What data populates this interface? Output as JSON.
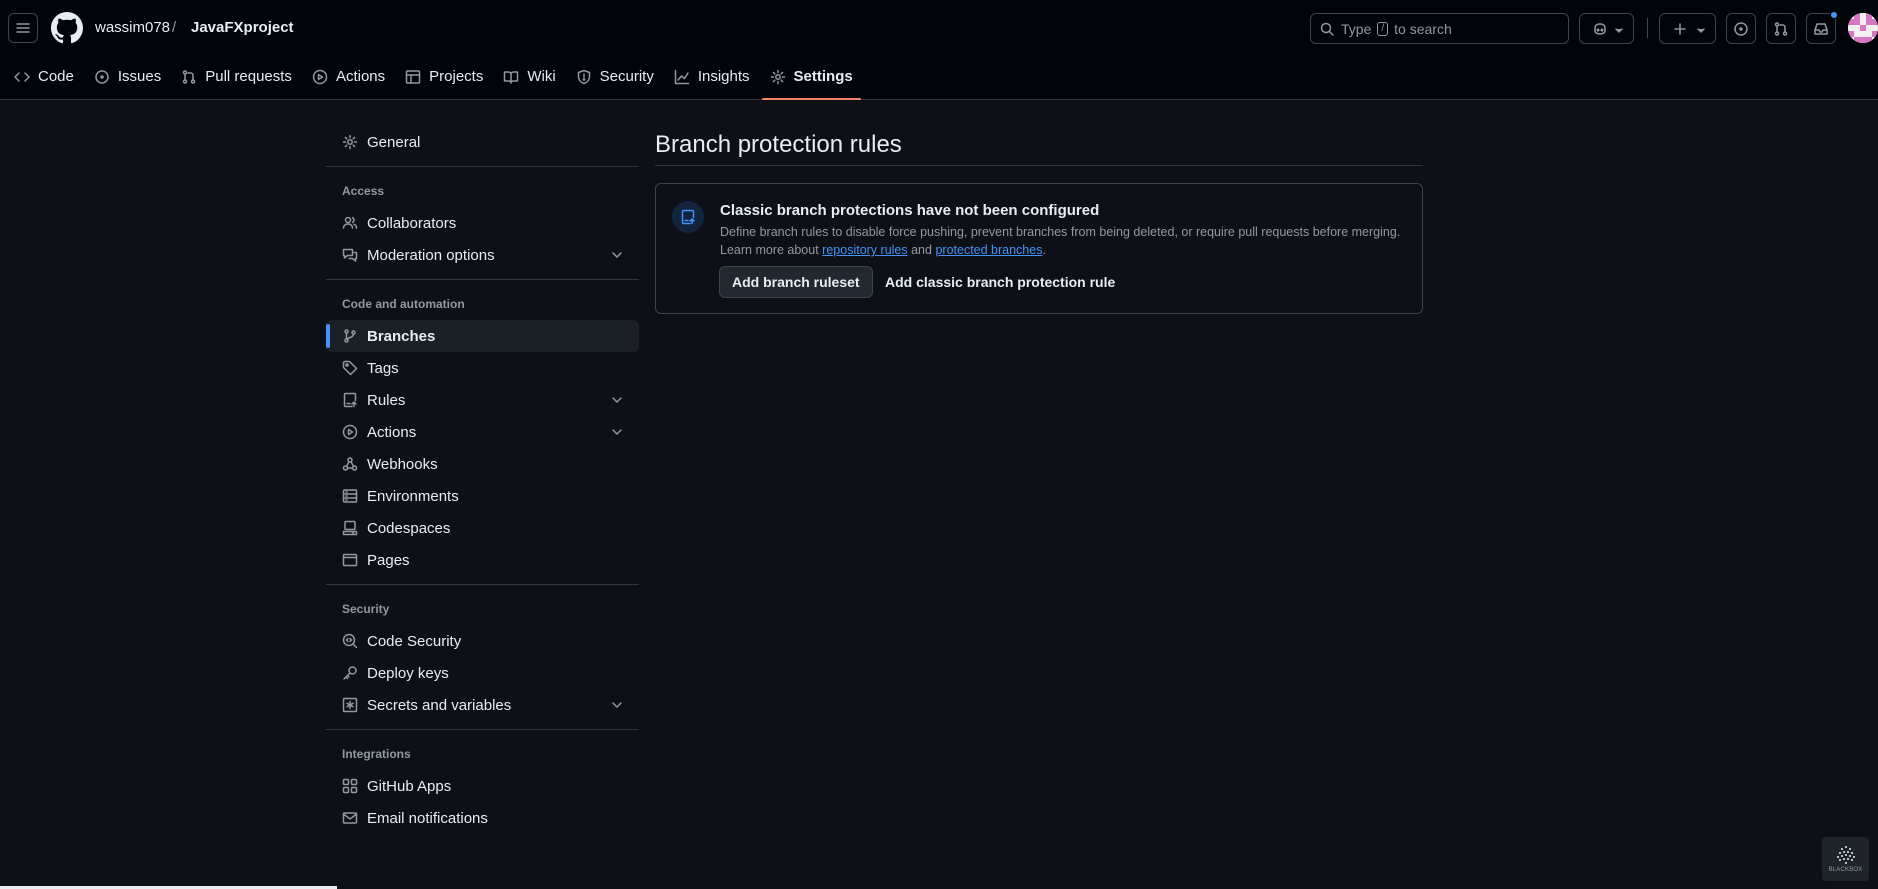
{
  "header": {
    "owner": "wassim078",
    "separator": "/",
    "repo": "JavaFXproject",
    "search_prefix": "Type",
    "search_key": "/",
    "search_suffix": "to search"
  },
  "tabs": [
    {
      "label": "Code",
      "icon": "code-icon"
    },
    {
      "label": "Issues",
      "icon": "issue-icon"
    },
    {
      "label": "Pull requests",
      "icon": "pull-request-icon"
    },
    {
      "label": "Actions",
      "icon": "play-icon"
    },
    {
      "label": "Projects",
      "icon": "table-icon"
    },
    {
      "label": "Wiki",
      "icon": "book-icon"
    },
    {
      "label": "Security",
      "icon": "shield-icon"
    },
    {
      "label": "Insights",
      "icon": "graph-icon"
    },
    {
      "label": "Settings",
      "icon": "gear-icon",
      "active": true
    }
  ],
  "sidebar": {
    "general": "General",
    "access_heading": "Access",
    "collaborators": "Collaborators",
    "moderation": "Moderation options",
    "code_heading": "Code and automation",
    "branches": "Branches",
    "tags": "Tags",
    "rules": "Rules",
    "actions": "Actions",
    "webhooks": "Webhooks",
    "environments": "Environments",
    "codespaces": "Codespaces",
    "pages": "Pages",
    "security_heading": "Security",
    "code_security": "Code Security",
    "deploy_keys": "Deploy keys",
    "secrets": "Secrets and variables",
    "integrations_heading": "Integrations",
    "github_apps": "GitHub Apps",
    "email_notifications": "Email notifications"
  },
  "main": {
    "title": "Branch protection rules",
    "blank_title": "Classic branch protections have not been configured",
    "desc_line1": "Define branch rules to disable force pushing, prevent branches from being deleted, or require pull requests before merging.",
    "desc_learn": "Learn more about",
    "link_rules": "repository rules",
    "desc_and": "and",
    "link_protected": "protected branches",
    "desc_end": ".",
    "btn_ruleset": "Add branch ruleset",
    "btn_classic": "Add classic branch protection rule"
  },
  "watermark": "BLACKBOX",
  "colors": {
    "background": "#0d1117",
    "header": "#010409",
    "accent_link": "#4493f8",
    "tab_underline": "#f78166"
  }
}
